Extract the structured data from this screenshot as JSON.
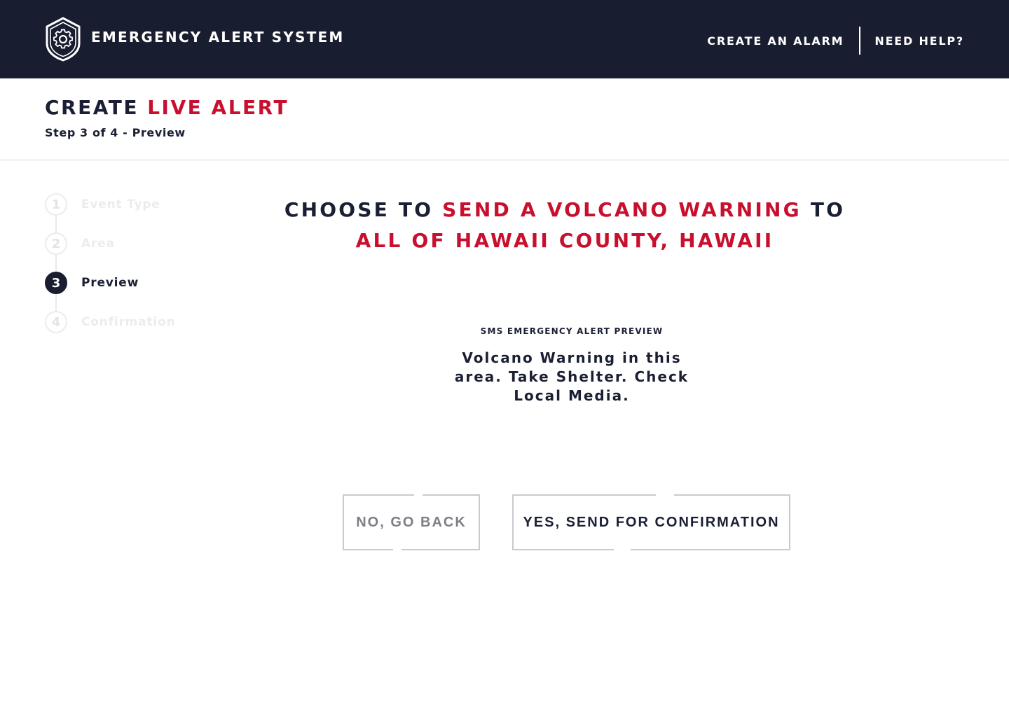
{
  "header": {
    "app_title": "EMERGENCY ALERT SYSTEM",
    "logo_icon": "shield-gear-icon",
    "nav": {
      "create_alarm": "CREATE AN ALARM",
      "need_help": "NEED HELP?"
    },
    "background_color": "#191d30"
  },
  "page": {
    "title_prefix": "CREATE",
    "title_highlight": "LIVE ALERT",
    "step_text": "Step 3 of 4 - Preview",
    "accent_color": "#c8102e"
  },
  "stepper": {
    "steps": [
      {
        "number": "1",
        "label": "Event Type",
        "state": "inactive"
      },
      {
        "number": "2",
        "label": "Area",
        "state": "inactive"
      },
      {
        "number": "3",
        "label": "Preview",
        "state": "active"
      },
      {
        "number": "4",
        "label": "Confirmation",
        "state": "inactive"
      }
    ]
  },
  "main": {
    "headline": {
      "part1": "CHOOSE TO",
      "action": "SEND A VOLCANO WARNING",
      "part2": "TO",
      "target": "ALL OF HAWAII COUNTY, HAWAII"
    },
    "sms_preview": {
      "label": "SMS EMERGENCY ALERT PREVIEW",
      "message": "Volcano Warning in this area. Take Shelter. Check Local Media."
    },
    "buttons": {
      "back": "NO, GO BACK",
      "confirm": "YES, SEND FOR CONFIRMATION"
    }
  }
}
